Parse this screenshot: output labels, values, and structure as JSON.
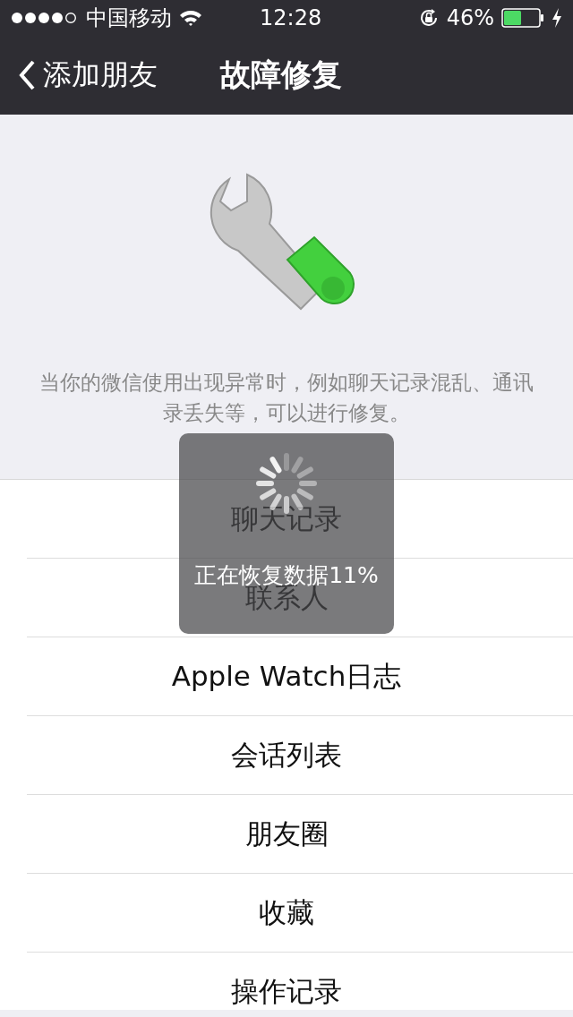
{
  "status_bar": {
    "carrier": "中国移动",
    "time": "12:28",
    "battery": "46%"
  },
  "nav": {
    "back_label": "添加朋友",
    "title": "故障修复"
  },
  "description": "当你的微信使用出现异常时，例如聊天记录混乱、通讯录丢失等，可以进行修复。",
  "items": [
    {
      "label": "聊天记录"
    },
    {
      "label": "联系人"
    },
    {
      "label": "Apple Watch日志"
    },
    {
      "label": "会话列表"
    },
    {
      "label": "朋友圈"
    },
    {
      "label": "收藏"
    },
    {
      "label": "操作记录"
    }
  ],
  "progress_hud": {
    "message": "正在恢复数据11%"
  }
}
